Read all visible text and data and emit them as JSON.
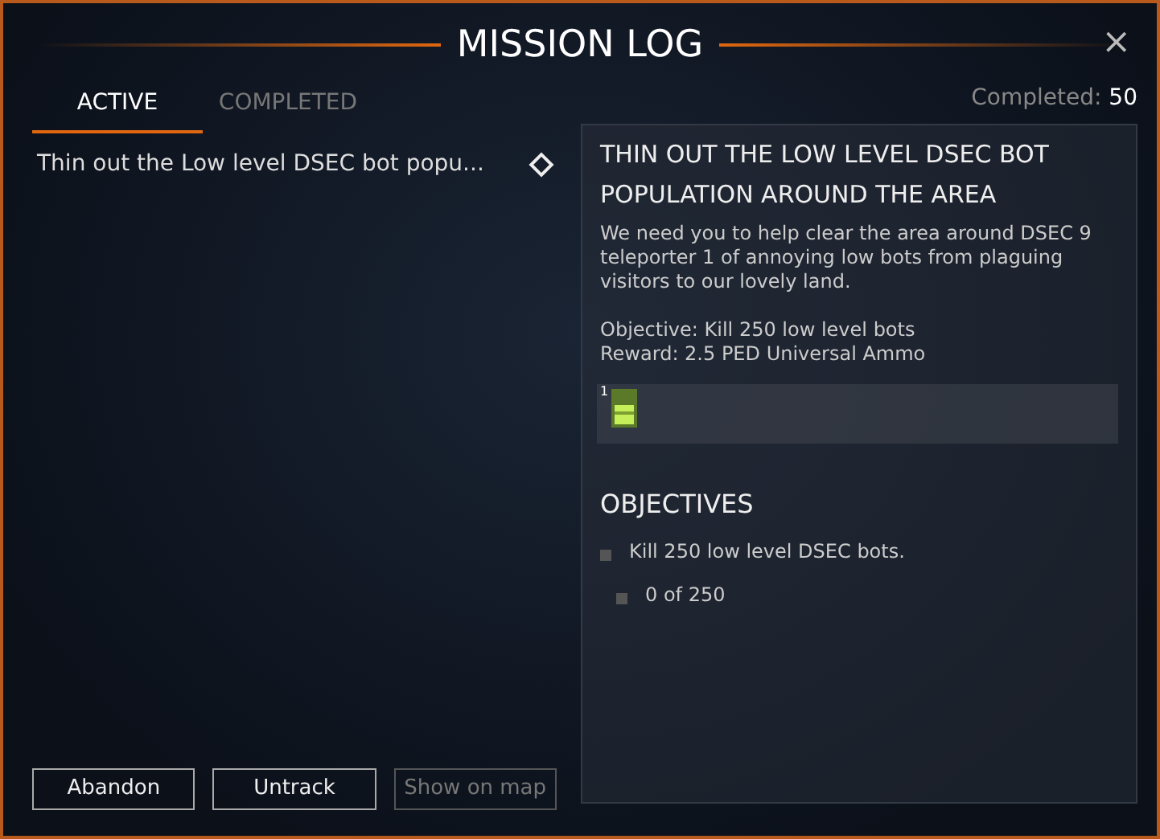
{
  "window": {
    "title": "MISSION LOG",
    "close": "×"
  },
  "tabs": [
    {
      "label": "ACTIVE",
      "selected": true
    },
    {
      "label": "COMPLETED",
      "selected": false
    }
  ],
  "completed": {
    "label": "Completed:",
    "value": "50"
  },
  "missions": [
    {
      "name": "Thin out the Low level DSEC bot popu...",
      "tracked": false,
      "selected": false
    }
  ],
  "buttons": [
    {
      "label": "Abandon",
      "disabled": false
    },
    {
      "label": "Untrack",
      "disabled": false
    },
    {
      "label": "Show on map",
      "disabled": true
    }
  ],
  "detail": {
    "title": "THIN OUT THE LOW LEVEL DSEC BOT POPULATION AROUND THE AREA",
    "description": "We need you to help clear the area around DSEC 9 teleporter 1 of annoying low bots from plaguing visitors to our lovely land.",
    "objective": "Objective: Kill 250 low level bots",
    "reward": "Reward: 2.5 PED  Universal Ammo",
    "reward_items": [
      {
        "count": "1"
      }
    ],
    "objectives_heading": "OBJECTIVES",
    "objectives": [
      {
        "text": "Kill 250 low level DSEC bots.",
        "checked": false,
        "children": [
          {
            "text": "0 of 250",
            "checked": false
          }
        ]
      }
    ]
  }
}
